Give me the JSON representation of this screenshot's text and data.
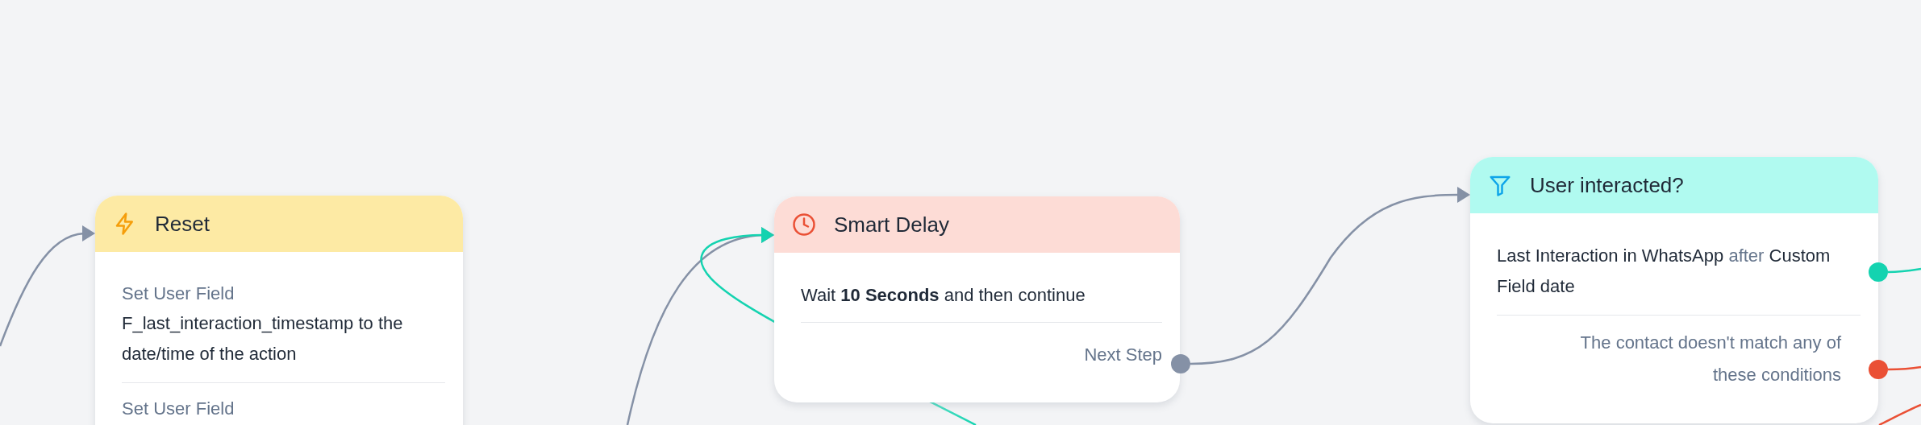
{
  "nodes": [
    {
      "kind": "action",
      "title": "Reset",
      "steps": [
        {
          "label": "Set User Field",
          "text": "F_last_interaction_timestamp to the date/time of the action"
        },
        {
          "label": "Set User Field"
        }
      ]
    },
    {
      "kind": "delay",
      "title": "Smart Delay",
      "text": "Wait **10 Seconds** and then continue",
      "output": "Next Step"
    },
    {
      "kind": "condition",
      "title": "User interacted?",
      "condition": {
        "field": "Last Interaction in WhatsApp",
        "operator": "after",
        "value": "Custom Field date",
        "color": "#14d3b0"
      },
      "fallback": {
        "text": "The contact doesn't match any of these conditions",
        "color": "#ea5035"
      }
    }
  ]
}
